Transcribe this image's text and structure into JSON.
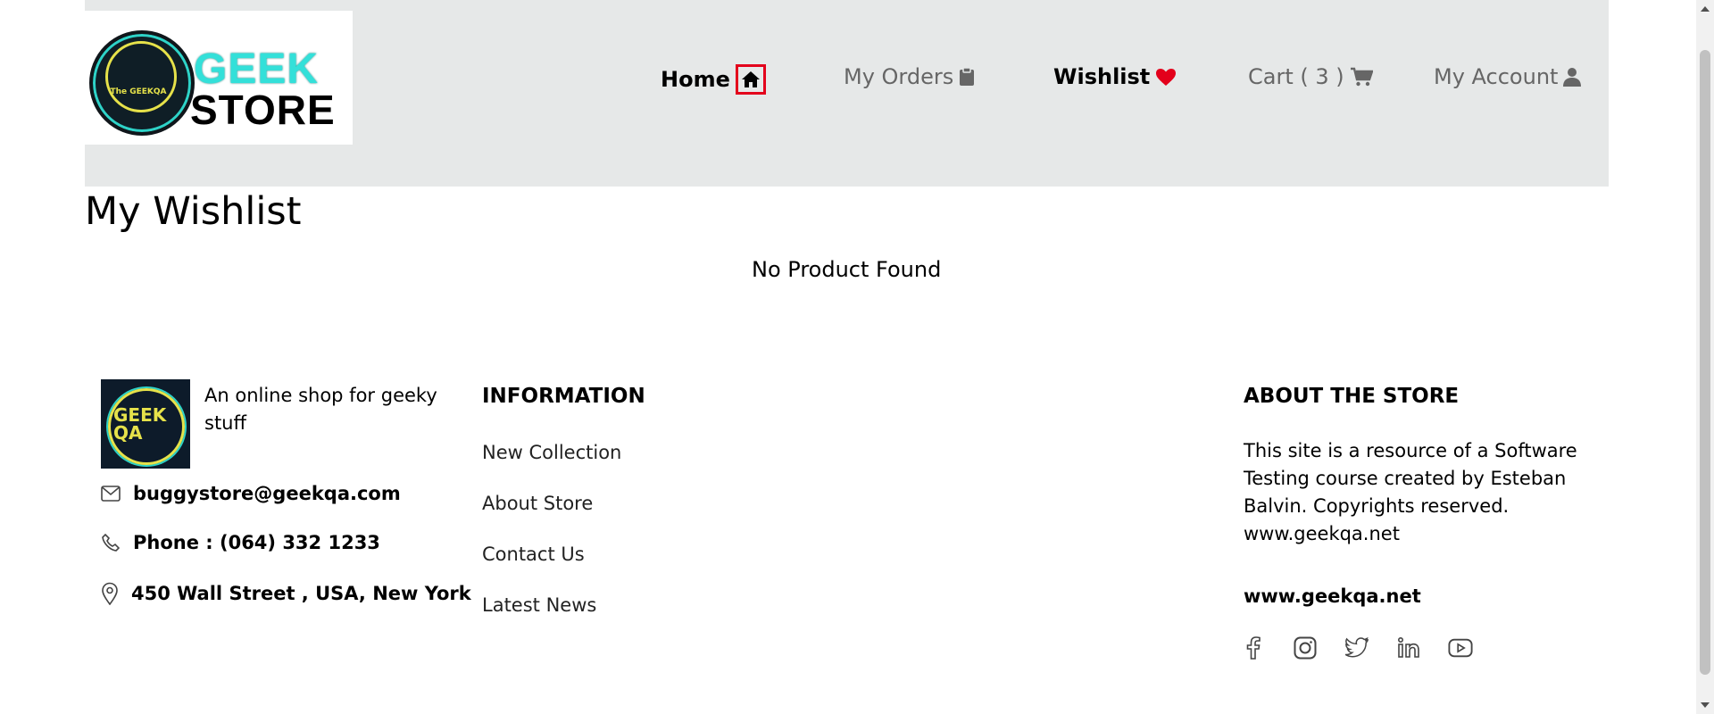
{
  "header": {
    "logo": {
      "line1": "GEEK",
      "line2": "STORE",
      "badge": "The GEEKQA"
    },
    "nav": {
      "home": "Home",
      "orders": "My Orders",
      "wishlist": "Wishlist",
      "cart": "Cart ( 3 )",
      "account": "My Account"
    }
  },
  "main": {
    "title": "My Wishlist",
    "empty_message": "No Product Found"
  },
  "footer": {
    "logo_text": "GEEK QA",
    "tagline": "An online shop for geeky stuff",
    "email": "buggystore@geekqa.com",
    "phone": "Phone : (064) 332 1233",
    "address": "450 Wall Street , USA, New York",
    "information": {
      "title": "INFORMATION",
      "links": [
        "New Collection",
        "About Store",
        "Contact Us",
        "Latest News"
      ]
    },
    "about": {
      "title": "ABOUT THE STORE",
      "text": "This site is a resource of a Software Testing course created by Esteban Balvin. Copyrights reserved. www.geekqa.net",
      "url": "www.geekqa.net"
    },
    "socials": [
      "facebook-icon",
      "instagram-icon",
      "twitter-icon",
      "linkedin-icon",
      "youtube-icon"
    ]
  },
  "colors": {
    "header_bg": "#e6e8e8",
    "accent_red": "#e3001b",
    "logo_teal": "#33e0d9"
  }
}
